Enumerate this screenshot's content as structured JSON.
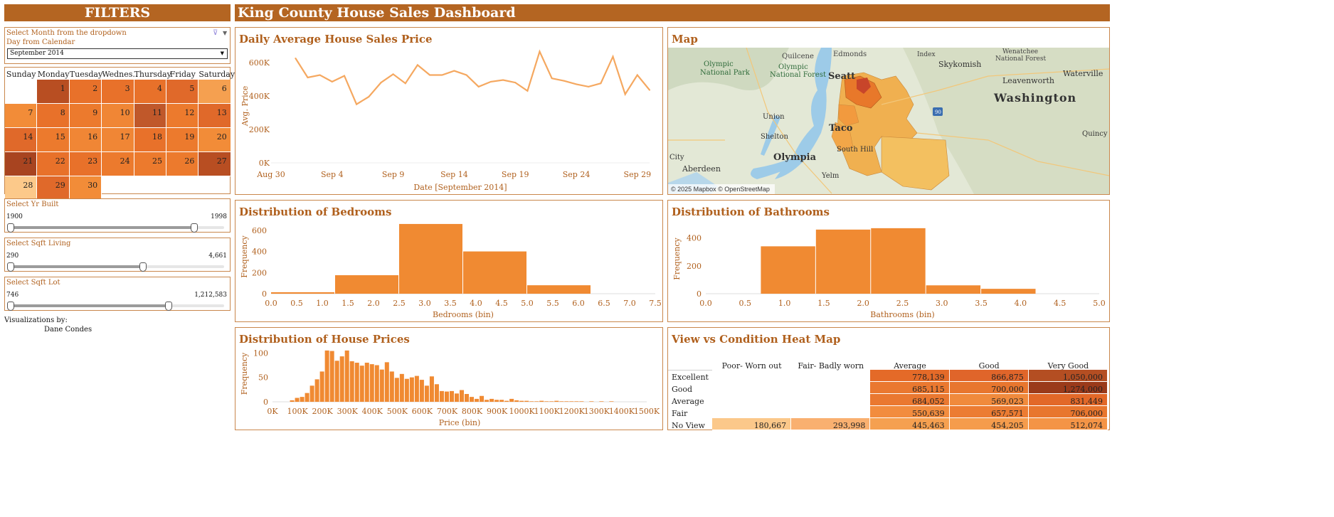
{
  "header": {
    "filters_title": "FILTERS",
    "dashboard_title": "King County House Sales Dashboard"
  },
  "filters": {
    "month_label": "Select Month from the dropdown",
    "day_label": "Day from Calendar",
    "month_value": "September 2014",
    "calendar": {
      "days_of_week": [
        "Sunday",
        "Monday",
        "Tuesday",
        "Wednes..",
        "Thursday",
        "Friday",
        "Saturday"
      ],
      "day_colors": {
        "1": "#b84e22",
        "2": "#e8712a",
        "3": "#e8712a",
        "4": "#e8712a",
        "5": "#e0692a",
        "6": "#f5a050",
        "7": "#f28c38",
        "8": "#e8712a",
        "9": "#ec7a2d",
        "10": "#f08635",
        "11": "#c0582a",
        "12": "#ec7a2d",
        "13": "#e0692a",
        "14": "#e0692a",
        "15": "#ec7a2d",
        "16": "#f08635",
        "17": "#f08635",
        "18": "#e8712a",
        "19": "#ec7a2d",
        "20": "#f28c38",
        "21": "#a84420",
        "22": "#e8712a",
        "23": "#e8712a",
        "24": "#ec7a2d",
        "25": "#ec7a2d",
        "26": "#ec7a2d",
        "27": "#b84e22",
        "28": "#fcc98a",
        "29": "#e0692a",
        "30": "#f28c38"
      }
    },
    "yr_built": {
      "label": "Select Yr Built",
      "min": "1900",
      "max": "1998",
      "fraction": 0.86
    },
    "sqft_living": {
      "label": "Select Sqft Living",
      "min": "290",
      "max": "4,661",
      "fraction": 0.62
    },
    "sqft_lot": {
      "label": "Select Sqft Lot",
      "min": "746",
      "max": "1,212,583",
      "fraction": 0.74
    },
    "credits_line1": "Visualizations by:",
    "credits_line2": "Dane Condes"
  },
  "charts": {
    "daily_price": {
      "title": "Daily Average House Sales Price",
      "ylabel": "Avg. Price",
      "xlabel": "Date [September 2014]",
      "xticks": [
        "Aug 30",
        "Sep 4",
        "Sep 9",
        "Sep 14",
        "Sep 19",
        "Sep 24",
        "Sep 29"
      ],
      "yticks": [
        "0K",
        "200K",
        "400K",
        "600K"
      ]
    },
    "map": {
      "title": "Map",
      "labels": {
        "quilcene": "Quilcene",
        "edmonds": "Edmonds",
        "index": "Index",
        "wenatchee": "Wenatchee",
        "wenatchee2": "National Forest",
        "olympic_np1": "Olympic",
        "olympic_np2": "National Park",
        "olympic_nf1": "Olympic",
        "olympic_nf2": "National Forest",
        "skykomish": "Skykomish",
        "leavenworth": "Leavenworth",
        "waterville": "Waterville",
        "washington": "Washington",
        "seattle": "Seatt",
        "union": "Union",
        "shelton": "Shelton",
        "tacoma": "Taco",
        "quincy": "Quincy",
        "olympia": "Olympia",
        "south_hill": "South Hill",
        "city": "City",
        "aberdeen": "Aberdeen",
        "yelm": "Yelm",
        "i90": "90"
      },
      "attribution": "© 2025 Mapbox  © OpenStreetMap"
    },
    "bedrooms": {
      "title": "Distribution of Bedrooms",
      "ylabel": "Frequency",
      "xlabel": "Bedrooms (bin)",
      "xticks": [
        "0.0",
        "0.5",
        "1.0",
        "1.5",
        "2.0",
        "2.5",
        "3.0",
        "3.5",
        "4.0",
        "4.5",
        "5.0",
        "5.5",
        "6.0",
        "6.5",
        "7.0",
        "7.5"
      ],
      "yticks": [
        "0",
        "200",
        "400",
        "600"
      ]
    },
    "bathrooms": {
      "title": "Distribution of Bathrooms",
      "ylabel": "Frequency",
      "xlabel": "Bathrooms (bin)",
      "xticks": [
        "0.0",
        "0.5",
        "1.0",
        "1.5",
        "2.0",
        "2.5",
        "3.0",
        "3.5",
        "4.0",
        "4.5",
        "5.0"
      ],
      "yticks": [
        "0",
        "200",
        "400"
      ]
    },
    "prices": {
      "title": "Distribution of House Prices",
      "ylabel": "Frequency",
      "xlabel": "Price (bin)",
      "xticks": [
        "0K",
        "100K",
        "200K",
        "300K",
        "400K",
        "500K",
        "600K",
        "700K",
        "800K",
        "900K",
        "1000K",
        "1100K",
        "1200K",
        "1300K",
        "1400K",
        "1500K"
      ],
      "yticks": [
        "0",
        "50",
        "100"
      ]
    },
    "heatmap": {
      "title": "View vs Condition Heat Map",
      "columns": [
        "Poor- Worn out",
        "Fair- Badly worn",
        "Average",
        "Good",
        "Very Good"
      ],
      "rows": [
        {
          "label": "Excellent",
          "cells": [
            "",
            "",
            "778,139",
            "866,875",
            "1,050,000"
          ],
          "colors": [
            "",
            "",
            "#e46a28",
            "#e0652a",
            "#b44e22"
          ]
        },
        {
          "label": "Good",
          "cells": [
            "",
            "",
            "685,115",
            "700,000",
            "1,274,000"
          ],
          "colors": [
            "",
            "",
            "#ea7830",
            "#e8762e",
            "#9a3a1a"
          ]
        },
        {
          "label": "Average",
          "cells": [
            "",
            "",
            "684,052",
            "569,023",
            "831,449"
          ],
          "colors": [
            "",
            "",
            "#ea7830",
            "#f08a3c",
            "#e26828"
          ]
        },
        {
          "label": "Fair",
          "cells": [
            "",
            "",
            "550,639",
            "657,571",
            "706,000"
          ],
          "colors": [
            "",
            "",
            "#f28c3e",
            "#ec7c32",
            "#e8762e"
          ]
        },
        {
          "label": "No View",
          "cells": [
            "180,667",
            "293,998",
            "445,463",
            "454,205",
            "512,074"
          ],
          "colors": [
            "#fbc88a",
            "#f9b070",
            "#f5a050",
            "#f59c4c",
            "#f49446"
          ]
        }
      ]
    }
  },
  "chart_data": [
    {
      "type": "line",
      "title": "Daily Average House Sales Price",
      "xlabel": "Date [September 2014]",
      "ylabel": "Avg. Price",
      "x": [
        "2014-09-01",
        "2014-09-02",
        "2014-09-03",
        "2014-09-04",
        "2014-09-05",
        "2014-09-06",
        "2014-09-07",
        "2014-09-08",
        "2014-09-09",
        "2014-09-10",
        "2014-09-11",
        "2014-09-12",
        "2014-09-13",
        "2014-09-14",
        "2014-09-15",
        "2014-09-16",
        "2014-09-17",
        "2014-09-18",
        "2014-09-19",
        "2014-09-20",
        "2014-09-21",
        "2014-09-22",
        "2014-09-23",
        "2014-09-24",
        "2014-09-25",
        "2014-09-26",
        "2014-09-27",
        "2014-09-28",
        "2014-09-29",
        "2014-09-30"
      ],
      "values": [
        625000,
        510000,
        525000,
        485000,
        520000,
        350000,
        395000,
        480000,
        530000,
        475000,
        585000,
        525000,
        525000,
        550000,
        525000,
        455000,
        485000,
        495000,
        480000,
        430000,
        665000,
        505000,
        490000,
        470000,
        455000,
        475000,
        635000,
        410000,
        525000,
        435000
      ],
      "ylim": [
        0,
        680000
      ],
      "xlim": [
        "2014-08-30",
        "2014-09-30"
      ]
    },
    {
      "type": "bar",
      "title": "Distribution of Bedrooms",
      "xlabel": "Bedrooms (bin)",
      "ylabel": "Frequency",
      "bin_edges": [
        0.0,
        1.25,
        2.5,
        3.75,
        5.0,
        6.25
      ],
      "values": [
        14,
        175,
        660,
        400,
        80
      ],
      "xlim": [
        0,
        7.5
      ],
      "ylim": [
        0,
        700
      ]
    },
    {
      "type": "bar",
      "title": "Distribution of Bathrooms",
      "xlabel": "Bathrooms (bin)",
      "ylabel": "Frequency",
      "bin_edges": [
        0.7,
        1.4,
        2.1,
        2.8,
        3.5,
        4.2
      ],
      "values": [
        340,
        460,
        470,
        60,
        35
      ],
      "xlim": [
        0,
        5.0
      ],
      "ylim": [
        0,
        500
      ]
    },
    {
      "type": "bar",
      "title": "Distribution of House Prices",
      "xlabel": "Price (bin)",
      "ylabel": "Frequency",
      "bin_start": 70000,
      "bin_width": 20000,
      "values": [
        3,
        8,
        10,
        18,
        33,
        46,
        62,
        105,
        104,
        84,
        93,
        105,
        83,
        80,
        74,
        80,
        77,
        75,
        66,
        81,
        62,
        49,
        57,
        47,
        50,
        53,
        45,
        33,
        52,
        36,
        22,
        21,
        22,
        17,
        24,
        16,
        10,
        6,
        12,
        4,
        6,
        4,
        4,
        2,
        6,
        3,
        2,
        2,
        1,
        1,
        2,
        1,
        1,
        2,
        1,
        1,
        1,
        1,
        1,
        0,
        1,
        0,
        1,
        0,
        1
      ],
      "xlim": [
        0,
        1500000
      ],
      "ylim": [
        0,
        115
      ]
    }
  ]
}
